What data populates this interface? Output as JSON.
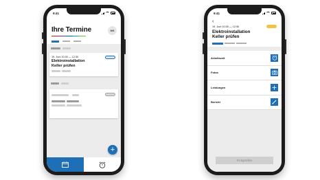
{
  "status_bar": {
    "time": "9:41"
  },
  "list_screen": {
    "title": "Ihre Termine",
    "avatar_initials": "MM",
    "cards": [
      {
        "date": "19. Juni 10:30 — 12:30",
        "title": "Elektroinstallation Keller prüfen"
      }
    ],
    "fab_label": "+"
  },
  "detail_screen": {
    "back_icon": "‹",
    "date": "19. Juni 10:30 — 12:30",
    "title": "Elektroinstallation Keller prüfen",
    "rows": [
      {
        "label": "Arbeitszeit",
        "icon": "stopwatch-icon"
      },
      {
        "label": "Fotos",
        "icon": "camera-icon"
      },
      {
        "label": "Leistungen",
        "icon": "plus-icon"
      },
      {
        "label": "Bericht",
        "icon": "pen-icon"
      }
    ],
    "finish_label": "Fertigstellen"
  },
  "colors": {
    "accent": "#1f6fb6",
    "status_amber": "#f3c244",
    "background": "#ececec"
  }
}
